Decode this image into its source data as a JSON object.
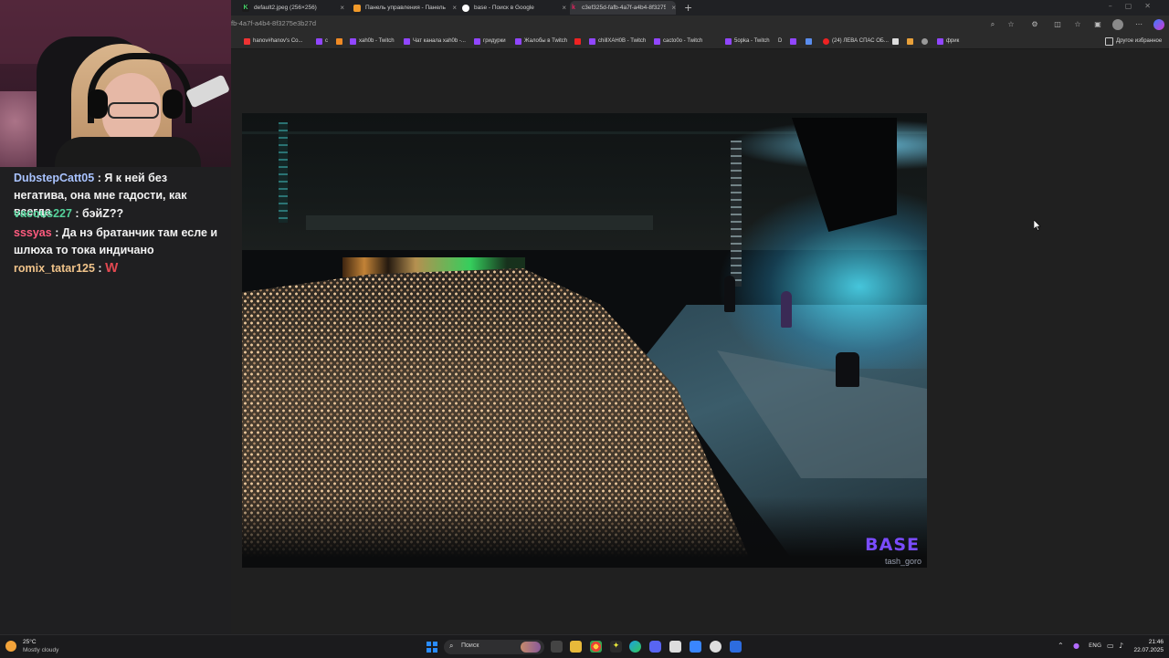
{
  "chat": {
    "messages": [
      {
        "user": "DubstepCatt05",
        "sep": " : ",
        "text": "Я к ней без негатива, она мне гадости, как всегда",
        "color": "#a9c3ff"
      },
      {
        "user": "vacous227",
        "sep": " : ",
        "text": "бэйZ??",
        "color": "#54d19a"
      },
      {
        "user": "sssyas",
        "sep": " : ",
        "text": "Да нэ братанчик там есле и шлюха то тока индичано",
        "color": "#ff5b7f"
      },
      {
        "user": "romix_tatar125",
        "sep": " : ",
        "text": "W",
        "color": "#f0c38a"
      }
    ]
  },
  "browser": {
    "tabs": [
      {
        "title": "default2.jpeg (256×256)",
        "favicon": "green-k-icon",
        "color": "#43d36a"
      },
      {
        "title": "Панель управления - Панель у...",
        "favicon": "orange-page-icon",
        "color": "#f19a2a"
      },
      {
        "title": "base - Поиск в Google",
        "favicon": "google-icon",
        "color": "#ffffff"
      },
      {
        "title": "c3ef325d-fafb-4a7f-a4b4-8f3275...",
        "favicon": "red-k-icon",
        "color": "#e0245e"
      }
    ],
    "new_tab": "+",
    "url": "fb-4a7f-a4b4-8f3275e3b27d",
    "bookmarks": [
      {
        "label": "hanov#hanov's Co...",
        "color": "#e33"
      },
      {
        "label": "с",
        "color": "#9146ff"
      },
      {
        "label": "",
        "color": "#f08a24"
      },
      {
        "label": "xah0b - Twitch",
        "color": "#9146ff"
      },
      {
        "label": "Чат канала xah0b -...",
        "color": "#9146ff"
      },
      {
        "label": "гридурки",
        "color": "#9146ff"
      },
      {
        "label": "Жалобы в Twitch",
        "color": "#9146ff"
      },
      {
        "label": "chillXAH0B - Twitch",
        "color": "#9146ff"
      },
      {
        "label": "cacto0o - Twitch",
        "color": "#9146ff"
      },
      {
        "label": "5opka - Twitch",
        "color": "#9146ff"
      },
      {
        "label": "D",
        "color": "#555"
      },
      {
        "label": "",
        "color": "#9146ff"
      },
      {
        "label": "",
        "color": "#5a8dee"
      },
      {
        "label": "(24) ЛЕВА СПАС ОБ...",
        "color": "#e22"
      },
      {
        "label": "",
        "color": "#ddd"
      },
      {
        "label": "",
        "color": "#e8a03a"
      },
      {
        "label": "",
        "color": "#999"
      },
      {
        "label": "фрик",
        "color": "#9146ff"
      }
    ],
    "other_bookmarks": "Другое избранное"
  },
  "photo": {
    "logo": "BASE",
    "credit": "tash_goro"
  },
  "taskbar": {
    "weather_temp": "25°C",
    "weather_desc": "Mostly cloudy",
    "search_placeholder": "Поиск",
    "lang": "ENG",
    "time": "21:46",
    "date": "22.07.2025"
  }
}
